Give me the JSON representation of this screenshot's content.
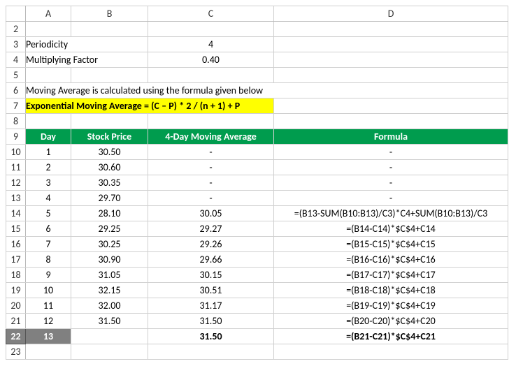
{
  "columns": [
    "A",
    "B",
    "C",
    "D"
  ],
  "params": {
    "periodicity_label": "Periodicity",
    "periodicity_value": "4",
    "mult_label": "Multiplying Factor",
    "mult_value": "0.40"
  },
  "note": "Moving Average is calculated using the formula given below",
  "highlight": "Exponential Moving Average = (C – P) * 2 / (n + 1) + P",
  "headers": {
    "day": "Day",
    "price": "Stock Price",
    "ma": "4-Day Moving Average",
    "formula": "Formula"
  },
  "rows": [
    {
      "r": 10,
      "day": "1",
      "price": "30.50",
      "ma": "-",
      "formula": "-"
    },
    {
      "r": 11,
      "day": "2",
      "price": "30.60",
      "ma": "-",
      "formula": "-"
    },
    {
      "r": 12,
      "day": "3",
      "price": "30.35",
      "ma": "-",
      "formula": "-"
    },
    {
      "r": 13,
      "day": "4",
      "price": "29.70",
      "ma": "-",
      "formula": "-"
    },
    {
      "r": 14,
      "day": "5",
      "price": "28.10",
      "ma": "30.05",
      "formula": "=(B13-SUM(B10:B13)/C3)*C4+SUM(B10:B13)/C3"
    },
    {
      "r": 15,
      "day": "6",
      "price": "29.25",
      "ma": "29.27",
      "formula": "=(B14-C14)*$C$4+C14"
    },
    {
      "r": 16,
      "day": "7",
      "price": "30.25",
      "ma": "29.26",
      "formula": "=(B15-C15)*$C$4+C15"
    },
    {
      "r": 17,
      "day": "8",
      "price": "30.90",
      "ma": "29.66",
      "formula": "=(B16-C16)*$C$4+C16"
    },
    {
      "r": 18,
      "day": "9",
      "price": "31.05",
      "ma": "30.15",
      "formula": "=(B17-C17)*$C$4+C17"
    },
    {
      "r": 19,
      "day": "10",
      "price": "32.15",
      "ma": "30.51",
      "formula": "=(B18-C18)*$C$4+C18"
    },
    {
      "r": 20,
      "day": "11",
      "price": "32.00",
      "ma": "31.17",
      "formula": "=(B19-C19)*$C$4+C19"
    },
    {
      "r": 21,
      "day": "12",
      "price": "31.50",
      "ma": "31.50",
      "formula": "=(B20-C20)*$C$4+C20"
    }
  ],
  "result_row": {
    "r": 22,
    "day": "13",
    "price": "",
    "ma": "31.50",
    "formula": "=(B21-C21)*$C$4+C21"
  }
}
